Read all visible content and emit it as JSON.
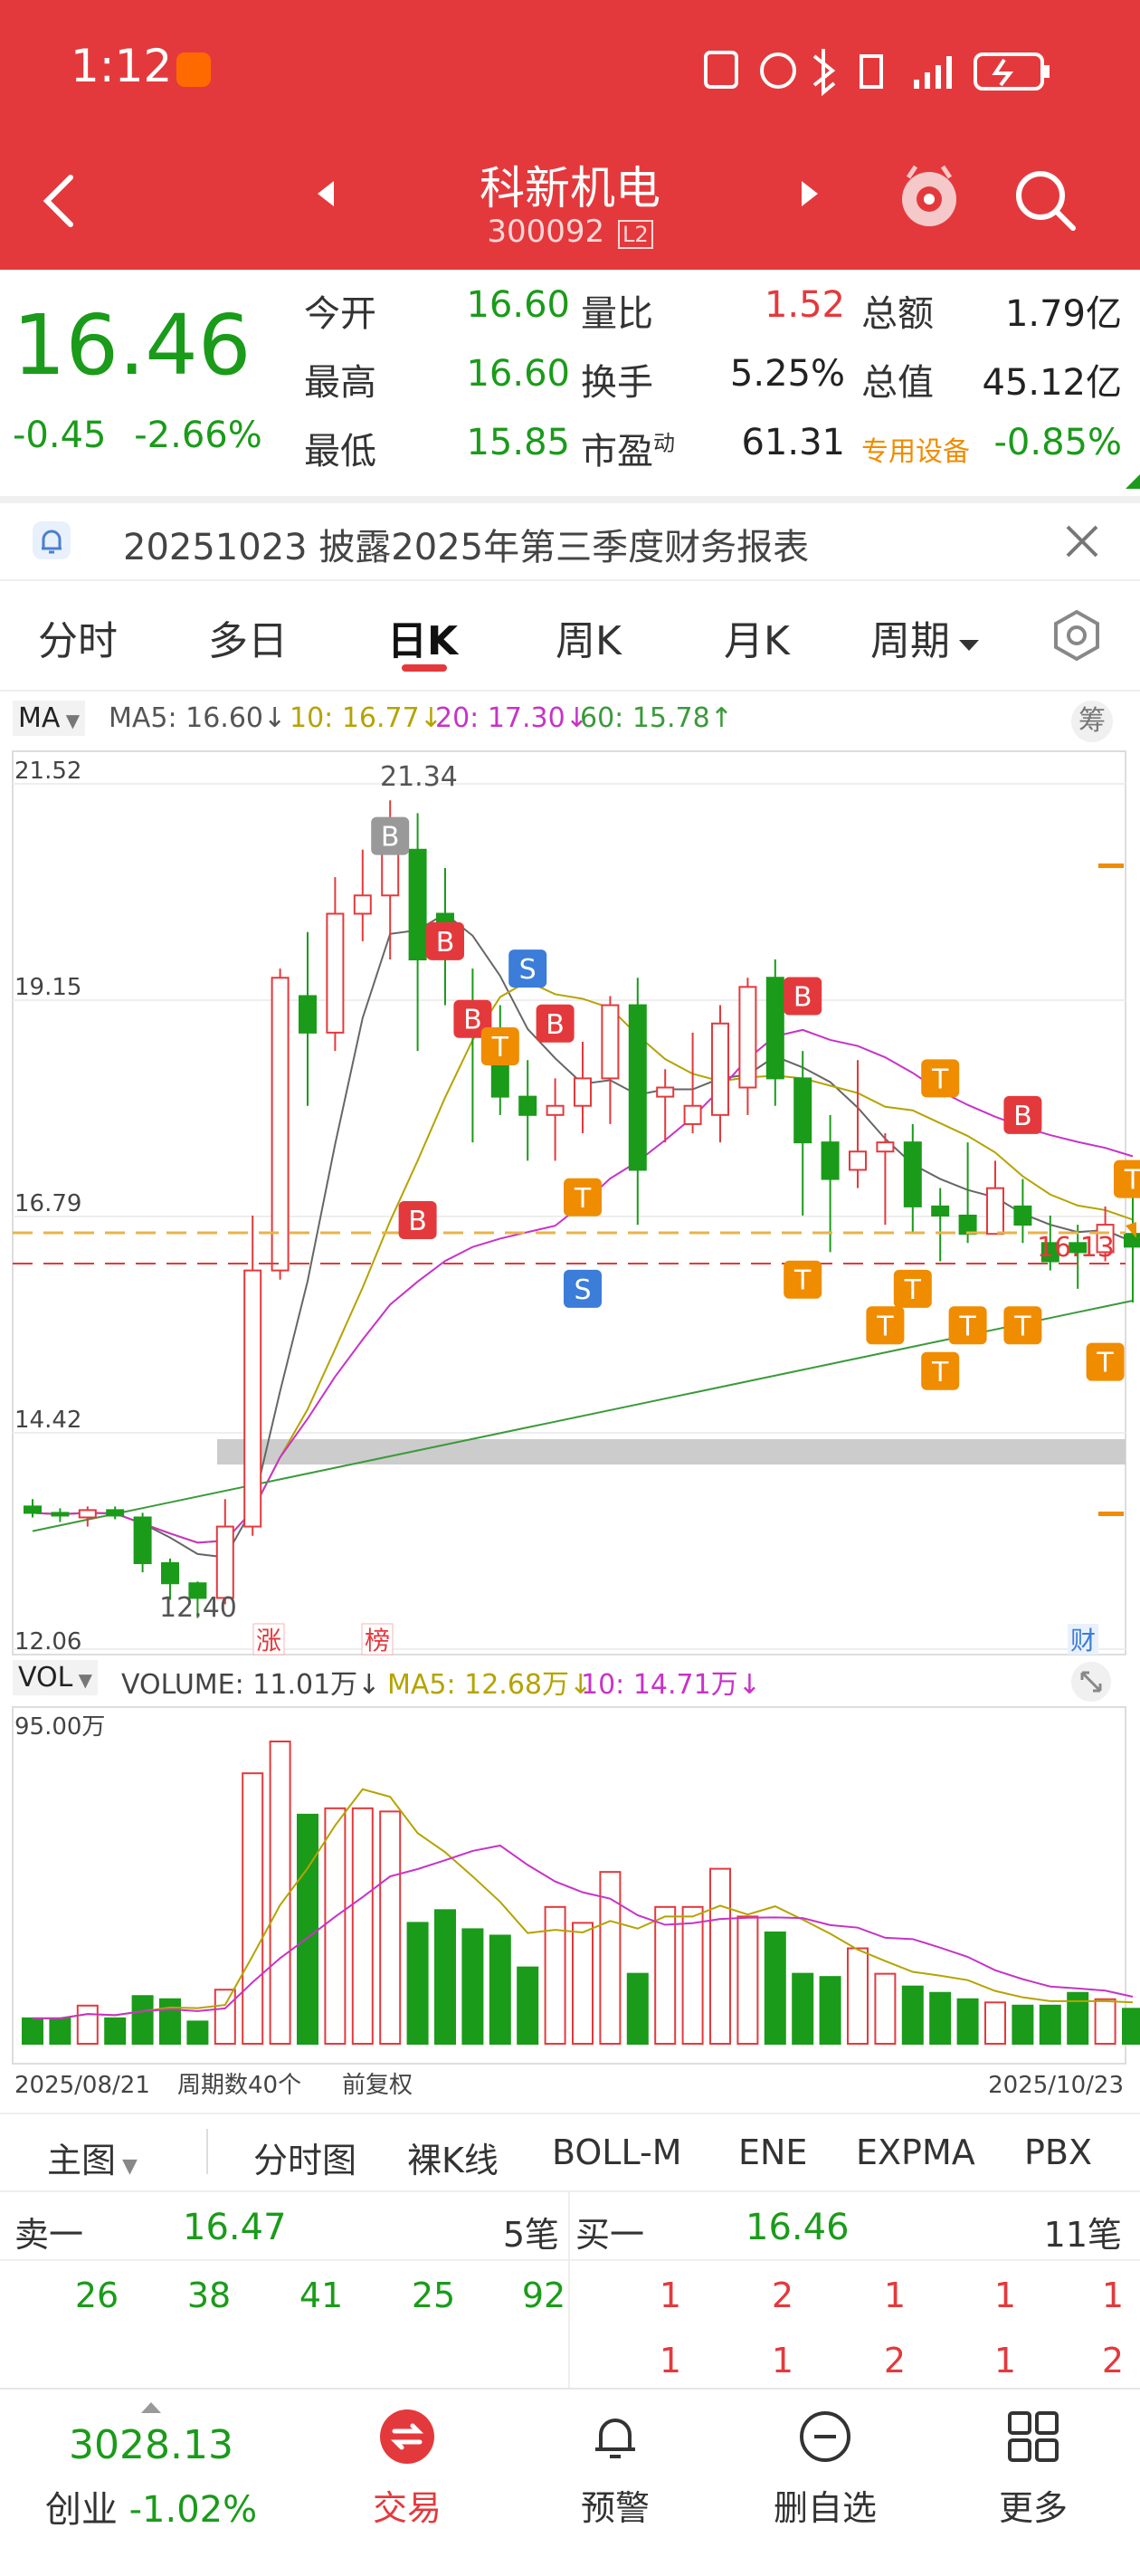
{
  "status_bar": {
    "time": "1:12"
  },
  "header": {
    "name": "科新机电",
    "code": "300092",
    "code_badge": "L2"
  },
  "quote": {
    "price": "16.46",
    "change": "-0.45",
    "change_pct": "-2.66%",
    "fields": [
      {
        "label": "今开",
        "value": "16.60"
      },
      {
        "label": "最高",
        "value": "16.60"
      },
      {
        "label": "最低",
        "value": "15.85"
      },
      {
        "label": "量比",
        "value": "1.52"
      },
      {
        "label": "换手",
        "value": "5.25%"
      },
      {
        "label": "市盈",
        "sup": "动",
        "value": "61.31"
      },
      {
        "label": "总额",
        "value": "1.79亿"
      },
      {
        "label": "总值",
        "value": "45.12亿"
      },
      {
        "label": "专用设备",
        "value": "-0.85%"
      }
    ]
  },
  "notice": {
    "text": "20251023 披露2025年第三季度财务报表"
  },
  "tabs": [
    "分时",
    "多日",
    "日K",
    "周K",
    "月K",
    "周期"
  ],
  "active_tab": "日K",
  "ma_bar": {
    "selector": "MA",
    "ma5": "MA5: 16.60↓",
    "ma10": "10: 16.77↓",
    "ma20": "20: 17.30↓",
    "ma60": "60: 15.78↑",
    "chip_btn": "筹"
  },
  "kline": {
    "y_labels": [
      "21.52",
      "19.15",
      "16.79",
      "14.42",
      "12.06"
    ],
    "high_label": "21.34",
    "low_label": "12.40",
    "current_label": "16.13",
    "markers_bottom": [
      "涨",
      "榜"
    ],
    "marker_right": "财",
    "colors": {
      "up": "#e4393c",
      "down": "#1a9b1a",
      "ma5": "#666666",
      "ma10": "#b5a300",
      "ma20": "#c733c7",
      "ma60": "#3a9a3a"
    }
  },
  "chart_data": {
    "type": "candlestick",
    "ylim": [
      12.06,
      21.52
    ],
    "ohlc": [
      [
        13.62,
        13.7,
        13.5,
        13.55
      ],
      [
        13.55,
        13.6,
        13.45,
        13.52
      ],
      [
        13.5,
        13.62,
        13.4,
        13.58
      ],
      [
        13.58,
        13.62,
        13.48,
        13.52
      ],
      [
        13.5,
        13.55,
        12.9,
        13.0
      ],
      [
        13.0,
        13.05,
        12.6,
        12.78
      ],
      [
        12.78,
        12.8,
        12.4,
        12.62
      ],
      [
        12.62,
        13.7,
        12.55,
        13.4
      ],
      [
        13.4,
        16.8,
        13.3,
        16.2
      ],
      [
        16.2,
        19.5,
        16.1,
        19.4
      ],
      [
        19.2,
        19.9,
        18.0,
        18.8
      ],
      [
        18.8,
        20.5,
        18.6,
        20.1
      ],
      [
        20.1,
        20.8,
        19.8,
        20.3
      ],
      [
        20.3,
        21.34,
        19.6,
        20.8
      ],
      [
        20.8,
        21.2,
        18.6,
        19.6
      ],
      [
        20.1,
        20.6,
        19.1,
        19.7
      ],
      [
        19.1,
        19.5,
        17.6,
        18.9
      ],
      [
        18.8,
        19.1,
        17.9,
        18.1
      ],
      [
        18.1,
        18.5,
        17.4,
        17.9
      ],
      [
        17.9,
        18.3,
        17.4,
        18.0
      ],
      [
        18.0,
        18.7,
        17.7,
        18.3
      ],
      [
        18.3,
        19.2,
        17.8,
        19.1
      ],
      [
        19.1,
        19.4,
        16.7,
        17.3
      ],
      [
        18.1,
        18.4,
        17.6,
        18.2
      ],
      [
        17.8,
        18.8,
        17.7,
        18.0
      ],
      [
        17.9,
        19.1,
        17.6,
        18.9
      ],
      [
        18.2,
        19.4,
        17.9,
        19.3
      ],
      [
        19.4,
        19.6,
        18.0,
        18.3
      ],
      [
        18.3,
        18.6,
        16.8,
        17.6
      ],
      [
        17.6,
        17.9,
        16.4,
        17.2
      ],
      [
        17.3,
        18.5,
        17.1,
        17.5
      ],
      [
        17.5,
        17.7,
        16.7,
        17.6
      ],
      [
        17.6,
        17.8,
        16.6,
        16.9
      ],
      [
        16.9,
        17.1,
        16.3,
        16.8
      ],
      [
        16.8,
        17.6,
        16.5,
        16.6
      ],
      [
        16.6,
        17.4,
        16.6,
        17.1
      ],
      [
        16.9,
        17.2,
        16.5,
        16.7
      ],
      [
        16.5,
        16.8,
        16.2,
        16.3
      ],
      [
        16.5,
        16.7,
        16.0,
        16.4
      ],
      [
        16.4,
        16.9,
        16.3,
        16.7
      ],
      [
        16.6,
        17.0,
        15.85,
        16.46
      ]
    ],
    "volume": [
      8,
      8,
      12,
      8,
      15,
      14,
      7,
      17,
      85,
      95,
      72,
      74,
      74,
      73,
      38,
      42,
      36,
      34,
      24,
      43,
      38,
      54,
      22,
      43,
      43,
      55,
      40,
      35,
      22,
      21,
      30,
      22,
      18,
      16,
      14,
      13,
      12,
      12,
      16,
      14,
      11
    ],
    "x_start": "2025/08/21",
    "x_end": "2025/10/23",
    "count_label": "周期数40个",
    "adjust_label": "前复权"
  },
  "vol_bar": {
    "selector": "VOL",
    "volume": "VOLUME: 11.01万↓",
    "ma5": "MA5: 12.68万↓",
    "ma10": "10: 14.71万↓",
    "max_label": "95.00万"
  },
  "indicator_tabs": {
    "main": "主图",
    "items": [
      "分时图",
      "裸K线",
      "BOLL-M",
      "ENE",
      "EXPMA",
      "PBX"
    ]
  },
  "order_book": {
    "sell_label": "卖一",
    "sell_price": "16.47",
    "sell_count": "5笔",
    "buy_label": "买一",
    "buy_price": "16.46",
    "buy_count": "11笔",
    "sell_queue": [
      "26",
      "38",
      "41",
      "25",
      "92"
    ],
    "buy_queue_1": [
      "1",
      "2",
      "1",
      "1",
      "1"
    ],
    "buy_queue_2": [
      "1",
      "1",
      "2",
      "1",
      "2"
    ]
  },
  "bottom_bar": {
    "index_value": "3028.13",
    "index_name": "创业",
    "index_change": "-1.02%",
    "items": [
      "交易",
      "预警",
      "删自选",
      "更多"
    ]
  }
}
